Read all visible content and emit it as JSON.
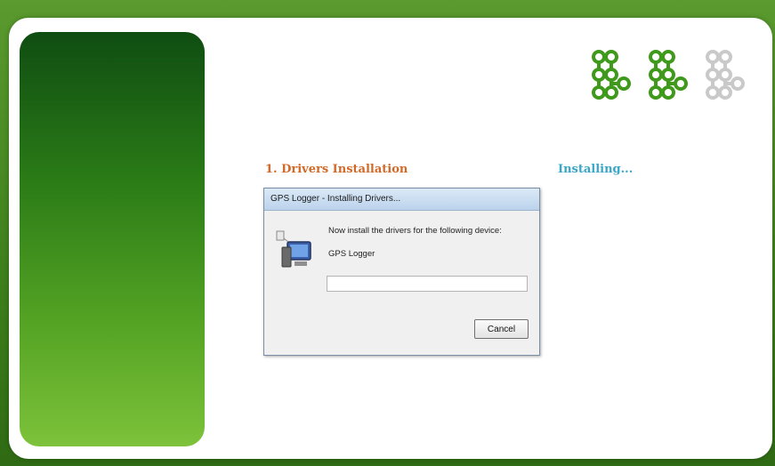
{
  "step": {
    "title": "1. Drivers Installation",
    "status": "Installing...",
    "progress_steps": {
      "completed": 2,
      "total": 3
    }
  },
  "dialog": {
    "title": "GPS Logger - Installing Drivers...",
    "message": "Now install the drivers for the following device:",
    "device_name": "GPS Logger",
    "progress": 0,
    "cancel_label": "Cancel"
  },
  "colors": {
    "step_title": "#d06a2a",
    "status": "#3aa6c8",
    "step_done": "#3f9a1c",
    "step_pending": "#c9c9c9"
  },
  "icons": {
    "step_markers": "chain-link-icon",
    "dialog_icon": "computer-install-icon"
  }
}
